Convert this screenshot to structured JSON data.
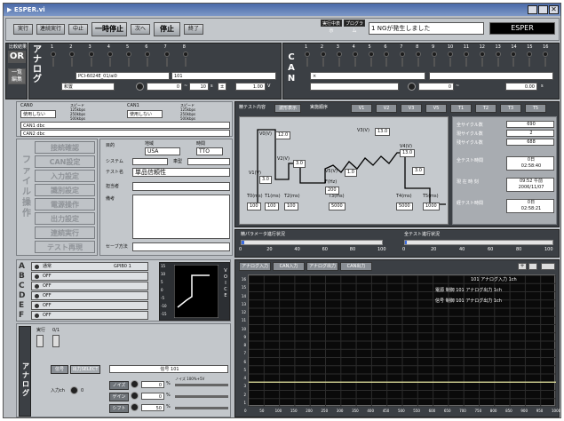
{
  "window": {
    "title": "ESPER.vi"
  },
  "toolbar": {
    "buttons": [
      "実行",
      "連続実行",
      "中止",
      "一時停止",
      "次へ",
      "停止",
      "終了"
    ],
    "status_labels": [
      "実行中表示",
      "プログラム"
    ],
    "message_index": "1",
    "message": "NGが発生しました",
    "app_name": "ESPER"
  },
  "left_controls": {
    "or_label": "OR",
    "or_caption": "比較結果",
    "list_button": "一覧\n編集"
  },
  "analog_inputs": {
    "vertical_label": "アナログ",
    "channels": [
      "1",
      "2",
      "3",
      "4",
      "5",
      "6",
      "7",
      "8"
    ],
    "device": "PCI-6024E_01/ai0",
    "dev_index": "101",
    "mode": "和置",
    "range_from": "0",
    "range_to": "10",
    "unit": "s",
    "sign": "±",
    "value": "1.00",
    "value_unit": "V"
  },
  "can_inputs": {
    "vertical_label": "CAN",
    "channels": [
      "1",
      "2",
      "3",
      "4",
      "5",
      "6",
      "7",
      "8",
      "9",
      "10",
      "11",
      "12",
      "13",
      "14",
      "15",
      "16"
    ],
    "box_value": "×",
    "range_from": "0",
    "value": "0.00",
    "value_unit": "s"
  },
  "can_ports": {
    "can0_label": "CAN0",
    "can0_mode": "使用しない",
    "can0_speed": "スピード\n125kbps\n250kbps\n500kbps",
    "can1_label": "CAN1",
    "can1_mode": "使用しない",
    "can1_speed": "スピード\n125kbps\n250kbps\n500kbps",
    "can1_db": "CAN1 dbc",
    "can2_db": "CAN2 dbc"
  },
  "file_ops": {
    "vertical_label": "ファイル操作",
    "items": [
      "接続確認",
      "CAN設定",
      "入力設定",
      "識別設定",
      "電源操作",
      "出力設定",
      "連続実行",
      "テスト再現"
    ]
  },
  "info_form": {
    "region_label": "地域",
    "region_value": "USA",
    "format_label": "時間",
    "format_value": "TTO",
    "purpose_label": "目的",
    "system_label": "システム",
    "car_label": "車型",
    "test_name_label": "テスト名",
    "test_name_value": "単品信頼性",
    "inspector_label": "担当者",
    "remarks_label": "備考",
    "save_label": "セーブ方法"
  },
  "test_content": {
    "header": "精テスト内容",
    "tab_waveform": "波形表示",
    "tab_order": "実施順序",
    "chips": [
      "V1",
      "V2",
      "V3",
      "V5",
      "T1",
      "T2",
      "T3",
      "T5"
    ],
    "waveform_labels": {
      "v0": "V0(V)",
      "v0_val": "12.0",
      "v1": "V1(V)",
      "v1_val": "3.0",
      "v2": "V2(V)",
      "v2_val": "3.0",
      "v3": "V3(V)",
      "v3_val": "13.0",
      "v4": "V4(V)",
      "v4_val": "13.0",
      "v5": "V5(V)",
      "v5_val": "1.0",
      "v5b_val": "3.0",
      "t0": "T0(ms)",
      "t0_val": "100",
      "t1": "T1(ms)",
      "t1_val": "100",
      "t2": "T2(ms)",
      "t2_val": "100",
      "t3": "T3(ms)",
      "t3_val": "5000",
      "t4": "T4(ms)",
      "t4_val": "5000",
      "t5": "T5(ms)",
      "t5_val": "1000",
      "f": "F(Hz)",
      "f_val": "200"
    }
  },
  "test_stats": {
    "total_cycles_label": "全サイクル数",
    "total_cycles": "690",
    "current_cycles_label": "現サイクル数",
    "current_cycles": "2",
    "remaining_cycles_label": "残サイクル数",
    "remaining_cycles": "688",
    "total_time_label": "全テスト時間",
    "total_time": "0日\n02:58:40",
    "now_label": "現 在 時 刻",
    "now": "09:52 午前\n2006/11/07",
    "elapsed_label": "経テスト時間",
    "elapsed": "0日\n02:58:21"
  },
  "progress": {
    "param_label": "精パラメータ進行状況",
    "param_fraction": 0.02,
    "param_ticks": [
      "0",
      "20",
      "40",
      "60",
      "80",
      "100"
    ],
    "total_label": "全テスト進行状況",
    "total_fraction": 0.01,
    "total_ticks": [
      "0",
      "20",
      "40",
      "60",
      "80",
      "100"
    ]
  },
  "channels_status": {
    "rows": [
      {
        "letter": "A",
        "state": "通常",
        "value": "GPIB0 1"
      },
      {
        "letter": "B",
        "state": "OFF",
        "value": ""
      },
      {
        "letter": "C",
        "state": "OFF",
        "value": ""
      },
      {
        "letter": "D",
        "state": "OFF",
        "value": ""
      },
      {
        "letter": "E",
        "state": "OFF",
        "value": ""
      },
      {
        "letter": "F",
        "state": "OFF",
        "value": ""
      }
    ],
    "mini_ticks": [
      "15",
      "10",
      "5",
      "0",
      "-5",
      "-10",
      "-15"
    ],
    "mini_vertical": "VOICE"
  },
  "bottom_left": {
    "vertical_label": "アナログ",
    "switch_labels": [
      "実行",
      "0/1"
    ],
    "tab_a": "信号",
    "tab_b": "出力SELECT",
    "input_label": "入力ch",
    "input_value": "0",
    "signal_label": "信号 101",
    "noise_label": "ノイズ 100%+5V",
    "rows": [
      {
        "name": "ノイズ",
        "value": "0",
        "unit": "%"
      },
      {
        "name": "ゲイン",
        "value": "0",
        "unit": "%"
      },
      {
        "name": "シフト",
        "value": "50",
        "unit": "%"
      }
    ]
  },
  "bottom_chart": {
    "tabs": [
      "アナログ入力",
      "CAN入力",
      "アナログ出力",
      "CAN出力"
    ],
    "legend_top": "101 アナログ入力 1ch",
    "legend_mid_prefix": "電源 制御",
    "legend_mid": "101 アナログ出力 1ch",
    "legend_bot_prefix": "信号 制御",
    "legend_bot": "101 アナログ出力 1ch",
    "y_ticks": [
      "16",
      "15",
      "14",
      "13",
      "12",
      "11",
      "10",
      "9",
      "8",
      "7",
      "6",
      "5",
      "4",
      "3",
      "2",
      "1"
    ],
    "x_ticks": [
      "0",
      "50",
      "100",
      "150",
      "200",
      "250",
      "300",
      "350",
      "400",
      "450",
      "500",
      "550",
      "600",
      "650",
      "700",
      "750",
      "800",
      "850",
      "900",
      "950",
      "1000"
    ],
    "line_level": 3
  }
}
